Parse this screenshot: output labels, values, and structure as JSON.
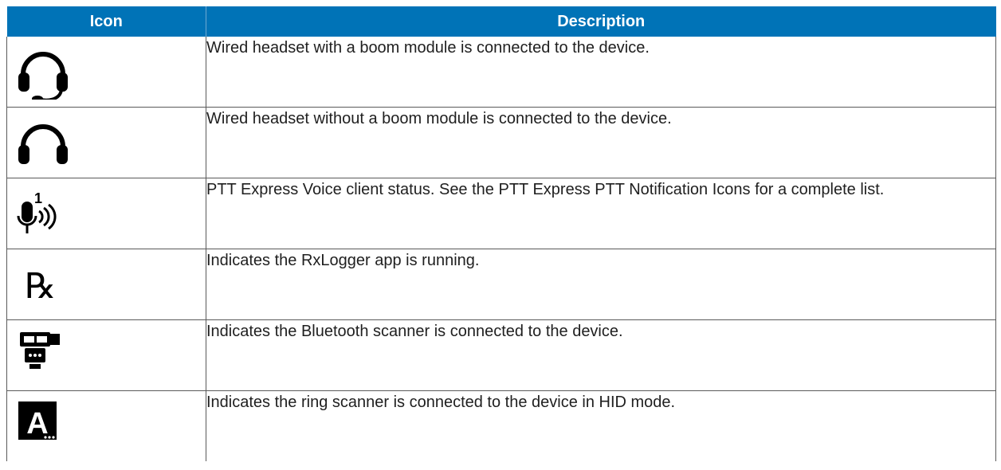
{
  "table": {
    "header": {
      "icon": "Icon",
      "description": "Description"
    },
    "rows": [
      {
        "icon_name": "headset-boom-icon",
        "description": "Wired headset with a boom module is connected to the device."
      },
      {
        "icon_name": "headset-icon",
        "description": "Wired headset without a boom module is connected to the device."
      },
      {
        "icon_name": "ptt-express-voice-icon",
        "description": "PTT Express Voice client status. See the PTT Express PTT Notification Icons for a complete list."
      },
      {
        "icon_name": "rxlogger-icon",
        "description": "Indicates the RxLogger app is running."
      },
      {
        "icon_name": "bluetooth-scanner-icon",
        "description": "Indicates the Bluetooth scanner is connected to the device."
      },
      {
        "icon_name": "ring-scanner-hid-icon",
        "description": "Indicates the ring scanner is connected to the device in HID mode."
      }
    ],
    "colors": {
      "header_bg": "#0073b7",
      "header_text": "#ffffff",
      "icon_fill": "#000000"
    }
  },
  "icons": {
    "ptt_badge": "1",
    "rx_glyph": "℞",
    "ring_letter": "A"
  }
}
